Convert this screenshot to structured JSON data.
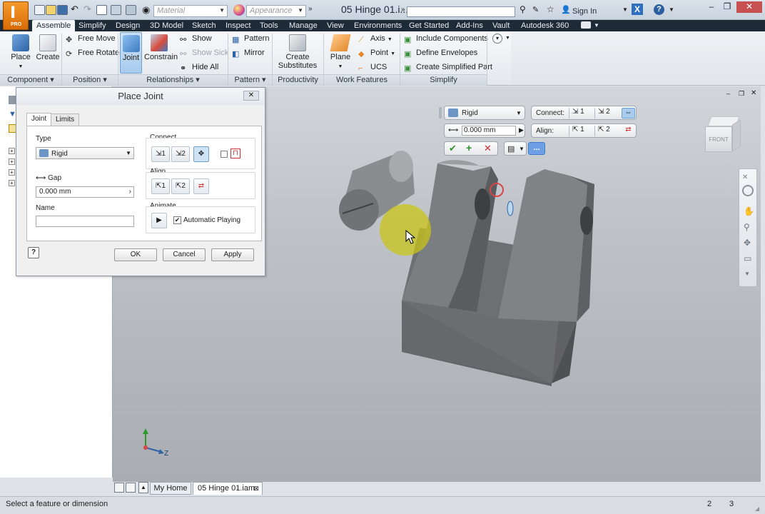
{
  "app": {
    "letter": "I",
    "edition": "PRO"
  },
  "titlebar": {
    "material_placeholder": "Material",
    "appearance_placeholder": "Appearance",
    "document_title": "05 Hinge 01.i...",
    "sign_in": "Sign In"
  },
  "tabs": [
    "Assemble",
    "Simplify",
    "Design",
    "3D Model",
    "Sketch",
    "Inspect",
    "Tools",
    "Manage",
    "View",
    "Environments",
    "Get Started",
    "Add-Ins",
    "Vault",
    "Autodesk 360"
  ],
  "ribbon": {
    "component": {
      "label": "Component",
      "place": "Place",
      "create": "Create"
    },
    "position": {
      "label": "Position",
      "free_move": "Free Move",
      "free_rotate": "Free Rotate"
    },
    "relationships": {
      "label": "Relationships",
      "joint": "Joint",
      "constrain": "Constrain",
      "show": "Show",
      "show_sick": "Show Sick",
      "hide_all": "Hide All"
    },
    "pattern": {
      "label": "Pattern",
      "pattern": "Pattern",
      "mirror": "Mirror"
    },
    "productivity": {
      "label": "Productivity",
      "create_substitutes_1": "Create",
      "create_substitutes_2": "Substitutes"
    },
    "work_features": {
      "label": "Work Features",
      "plane": "Plane",
      "axis": "Axis",
      "point": "Point",
      "ucs": "UCS"
    },
    "simplify": {
      "label": "Simplify",
      "include_components": "Include Components",
      "define_envelopes": "Define Envelopes",
      "create_simplified_part": "Create Simplified Part"
    }
  },
  "dialog": {
    "title": "Place Joint",
    "tabs": [
      "Joint",
      "Limits"
    ],
    "type_label": "Type",
    "type_value": "Rigid",
    "connect_label": "Connect",
    "connect_1": "1",
    "connect_2": "2",
    "gap_label": "Gap",
    "gap_value": "0.000 mm",
    "align_label": "Align",
    "align_1": "1",
    "align_2": "2",
    "name_label": "Name",
    "name_value": "",
    "animate_label": "Animate",
    "automatic_playing": "Automatic Playing",
    "ok": "OK",
    "cancel": "Cancel",
    "apply": "Apply"
  },
  "minitoolbar": {
    "type_value": "Rigid",
    "connect_label": "Connect:",
    "connect_1": "1",
    "connect_2": "2",
    "gap_value": "0.000 mm",
    "align_label": "Align:",
    "align_1": "1",
    "align_2": "2",
    "more": "..."
  },
  "viewcube": {
    "face": "FRONT"
  },
  "triad": {
    "z_label": "Z"
  },
  "doctabs": {
    "home": "My Home",
    "document": "05 Hinge 01.iam"
  },
  "status": {
    "message": "Select a feature or dimension",
    "count_1": "2",
    "count_2": "3"
  },
  "colors": {
    "accent": "#3f7cc9",
    "appbutton": "#e8820f",
    "tabbar": "#1f2a37",
    "cursor_highlight": "#c9c418"
  }
}
